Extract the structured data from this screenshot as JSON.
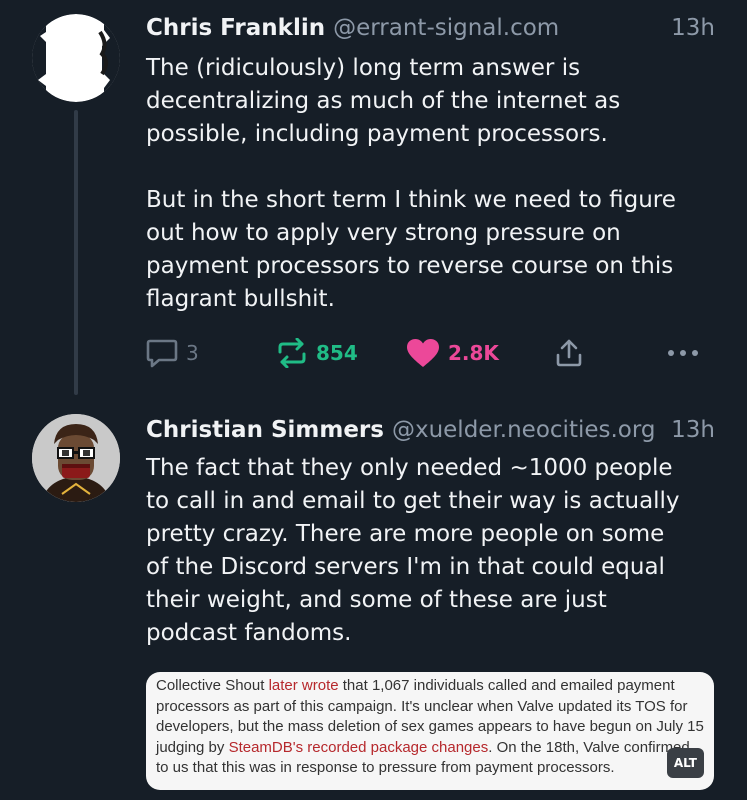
{
  "posts": [
    {
      "author": "Chris Franklin",
      "handle": "@errant-signal.com",
      "time": "13h",
      "text": "The (ridiculously) long term answer is\ndecentralizing as much of the internet as\npossible, including payment processors.\n\nBut in the short term I think we need to figure\nout how to apply very strong pressure on\npayment processors to reverse course on this\nflagrant bullshit.",
      "reply_count": "3",
      "repost_count": "854",
      "like_count": "2.8K",
      "icons": [
        "reply-icon",
        "repost-icon",
        "heart-icon",
        "share-icon",
        "more-icon"
      ]
    },
    {
      "author": "Christian Simmers",
      "handle": "@xuelder.neocities.org",
      "time": "13h",
      "text": "The fact that they only needed ~1000 people\nto call in and email to get their way is actually\npretty crazy. There are more people on some\nof the Discord servers I'm in that could equal\ntheir weight, and some of these are just\npodcast fandoms.",
      "embed": {
        "text_1": "Collective Shout ",
        "link_1": "later wrote",
        "text_2": " that 1,067 individuals called and emailed payment processors as part of this campaign. It's unclear when Valve updated its TOS for developers, but the mass deletion of sex games appears to have begun on July 15 judging by ",
        "link_2": "SteamDB's recorded package changes",
        "text_3": ". On the 18th, Valve confirmed to us that this was in response to pressure from payment processors.",
        "alt_label": "ALT",
        "link_color": "#b6282c"
      }
    }
  ],
  "colors": {
    "background": "#161e27",
    "repost": "#20bc86",
    "like": "#ec4899",
    "muted": "#8d99a8"
  }
}
